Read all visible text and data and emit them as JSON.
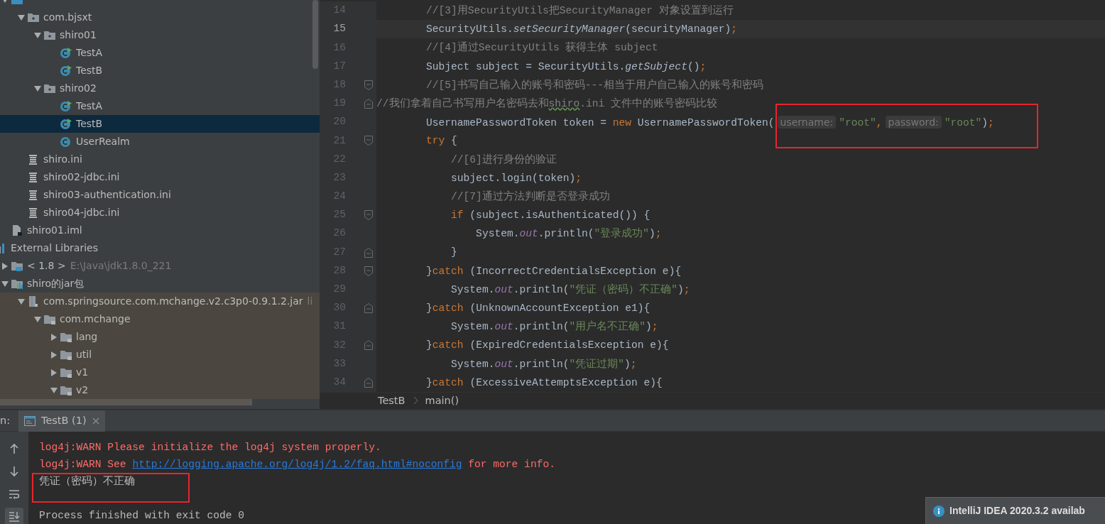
{
  "project_tree": {
    "module_items": [
      {
        "kind": "source-folder",
        "expanded": true,
        "selected": false,
        "children": [
          {
            "label": "com.bjsxt",
            "kind": "package",
            "expanded": true,
            "selected": false,
            "children": [
              {
                "label": "shiro01",
                "kind": "package",
                "expanded": true,
                "selected": false,
                "children": [
                  {
                    "label": "TestA",
                    "kind": "class-runnable",
                    "selected": false
                  },
                  {
                    "label": "TestB",
                    "kind": "class-runnable",
                    "selected": false
                  }
                ]
              },
              {
                "label": "shiro02",
                "kind": "package",
                "expanded": true,
                "selected": false,
                "children": [
                  {
                    "label": "TestA",
                    "kind": "class-runnable",
                    "selected": false
                  },
                  {
                    "label": "TestB",
                    "kind": "class-runnable",
                    "selected": true
                  },
                  {
                    "label": "UserRealm",
                    "kind": "class",
                    "selected": false
                  }
                ]
              }
            ]
          },
          {
            "label": "shiro.ini",
            "kind": "ini",
            "selected": false
          },
          {
            "label": "shiro02-jdbc.ini",
            "kind": "ini",
            "selected": false
          },
          {
            "label": "shiro03-authentication.ini",
            "kind": "ini",
            "selected": false
          },
          {
            "label": "shiro04-jdbc.ini",
            "kind": "ini",
            "selected": false
          }
        ]
      },
      {
        "label": "shiro01.iml",
        "kind": "iml",
        "selected": false
      }
    ],
    "libraries": [
      {
        "label": "External Libraries",
        "kind": "libraries",
        "selected": false,
        "children": [
          {
            "label": "< 1.8 >",
            "hint": "E:\\Java\\jdk1.8.0_221",
            "kind": "jdk",
            "expanded": false,
            "selected": false
          },
          {
            "label": "shiro的jar包",
            "kind": "library",
            "expanded": true,
            "selected": false,
            "children": [
              {
                "label": "com.springsource.com.mchange.v2.c3p0-0.9.1.2.jar",
                "hint": "li",
                "kind": "jar",
                "expanded": true,
                "selected": false,
                "non_project": true,
                "children": [
                  {
                    "label": "com.mchange",
                    "kind": "locked-folder",
                    "expanded": true,
                    "selected": false,
                    "non_project": true,
                    "children": [
                      {
                        "label": "lang",
                        "kind": "locked-folder",
                        "expanded": false,
                        "selected": false,
                        "non_project": true
                      },
                      {
                        "label": "util",
                        "kind": "locked-folder",
                        "expanded": false,
                        "selected": false,
                        "non_project": true
                      },
                      {
                        "label": "v1",
                        "kind": "locked-folder",
                        "expanded": false,
                        "selected": false,
                        "non_project": true
                      },
                      {
                        "label": "v2",
                        "kind": "locked-folder",
                        "expanded": true,
                        "selected": false,
                        "non_project": true
                      }
                    ]
                  }
                ]
              }
            ]
          }
        ]
      }
    ]
  },
  "editor": {
    "lines": [
      {
        "number": "14",
        "current": false,
        "kind": "plain",
        "segments": [
          {
            "kind": "comment",
            "text": "        //[3]用SecurityUtils把SecurityManager 对象设置到运行"
          }
        ]
      },
      {
        "number": "15",
        "current": true,
        "kind": "plain",
        "segments": [
          {
            "kind": "plain",
            "text": "        SecurityUtils."
          },
          {
            "kind": "method",
            "text": "setSecurityManager"
          },
          {
            "kind": "plain",
            "text": "(securityManager)"
          },
          {
            "kind": "punct",
            "text": ";"
          }
        ]
      },
      {
        "number": "16",
        "current": false,
        "kind": "plain",
        "segments": [
          {
            "kind": "comment",
            "text": "        //[4]通过SecurityUtils 获得主体 subject"
          }
        ]
      },
      {
        "number": "17",
        "current": false,
        "kind": "plain",
        "segments": [
          {
            "kind": "plain",
            "text": "        Subject subject = SecurityUtils."
          },
          {
            "kind": "method",
            "text": "getSubject"
          },
          {
            "kind": "plain",
            "text": "()"
          },
          {
            "kind": "punct",
            "text": ";"
          }
        ]
      },
      {
        "number": "18",
        "current": false,
        "kind": "fold-start",
        "segments": [
          {
            "kind": "comment",
            "text": "        //[5]书写自己输入的账号和密码---相当于用户自己输入的账号和密码"
          }
        ]
      },
      {
        "number": "19",
        "current": false,
        "kind": "fold-end",
        "segments": [
          {
            "kind": "comment",
            "text": "//我们拿着自己书写用户名密码去和"
          },
          {
            "kind": "typo",
            "text": "shiro"
          },
          {
            "kind": "comment",
            "text": ".ini 文件中的账号密码比较"
          }
        ]
      },
      {
        "number": "20",
        "current": false,
        "kind": "plain",
        "segments": [
          {
            "kind": "plain",
            "text": "        UsernamePasswordToken token = "
          },
          {
            "kind": "keyword",
            "text": "new"
          },
          {
            "kind": "plain",
            "text": " UsernamePasswordToken("
          },
          {
            "kind": "hint",
            "text": "username:"
          },
          {
            "kind": "string",
            "text": "\"root\""
          },
          {
            "kind": "punct",
            "text": ","
          },
          {
            "kind": "hint",
            "text": "password:"
          },
          {
            "kind": "string",
            "text": "\"root\""
          },
          {
            "kind": "plain",
            "text": ")"
          },
          {
            "kind": "punct",
            "text": ";"
          }
        ]
      },
      {
        "number": "21",
        "current": false,
        "kind": "fold-start",
        "segments": [
          {
            "kind": "keyword",
            "text": "        try"
          },
          {
            "kind": "plain",
            "text": " {"
          }
        ]
      },
      {
        "number": "22",
        "current": false,
        "kind": "plain",
        "segments": [
          {
            "kind": "comment",
            "text": "            //[6]进行身份的验证"
          }
        ]
      },
      {
        "number": "23",
        "current": false,
        "kind": "plain",
        "segments": [
          {
            "kind": "plain",
            "text": "            subject.login(token)"
          },
          {
            "kind": "punct",
            "text": ";"
          }
        ]
      },
      {
        "number": "24",
        "current": false,
        "kind": "plain",
        "segments": [
          {
            "kind": "comment",
            "text": "            //[7]通过方法判断是否登录成功"
          }
        ]
      },
      {
        "number": "25",
        "current": false,
        "kind": "fold-start",
        "segments": [
          {
            "kind": "keyword",
            "text": "            if"
          },
          {
            "kind": "plain",
            "text": " (subject.isAuthenticated()) {"
          }
        ]
      },
      {
        "number": "26",
        "current": false,
        "kind": "plain",
        "segments": [
          {
            "kind": "plain",
            "text": "                System."
          },
          {
            "kind": "field",
            "text": "out"
          },
          {
            "kind": "plain",
            "text": ".println("
          },
          {
            "kind": "string",
            "text": "\"登录成功\""
          },
          {
            "kind": "plain",
            "text": ")"
          },
          {
            "kind": "punct",
            "text": ";"
          }
        ]
      },
      {
        "number": "27",
        "current": false,
        "kind": "fold-end",
        "segments": [
          {
            "kind": "plain",
            "text": "            }"
          }
        ]
      },
      {
        "number": "28",
        "current": false,
        "kind": "fold-start",
        "segments": [
          {
            "kind": "plain",
            "text": "        }"
          },
          {
            "kind": "keyword",
            "text": "catch"
          },
          {
            "kind": "plain",
            "text": " (IncorrectCredentialsException e){"
          }
        ]
      },
      {
        "number": "29",
        "current": false,
        "kind": "plain",
        "segments": [
          {
            "kind": "plain",
            "text": "            System."
          },
          {
            "kind": "field",
            "text": "out"
          },
          {
            "kind": "plain",
            "text": ".println("
          },
          {
            "kind": "string",
            "text": "\"凭证（密码）不正确\""
          },
          {
            "kind": "plain",
            "text": ")"
          },
          {
            "kind": "punct",
            "text": ";"
          }
        ]
      },
      {
        "number": "30",
        "current": false,
        "kind": "fold-end",
        "segments": [
          {
            "kind": "plain",
            "text": "        }"
          },
          {
            "kind": "keyword",
            "text": "catch"
          },
          {
            "kind": "plain",
            "text": " (UnknownAccountException e1){"
          }
        ]
      },
      {
        "number": "31",
        "current": false,
        "kind": "plain",
        "segments": [
          {
            "kind": "plain",
            "text": "            System."
          },
          {
            "kind": "field",
            "text": "out"
          },
          {
            "kind": "plain",
            "text": ".println("
          },
          {
            "kind": "string",
            "text": "\"用户名不正确\""
          },
          {
            "kind": "plain",
            "text": ")"
          },
          {
            "kind": "punct",
            "text": ";"
          }
        ]
      },
      {
        "number": "32",
        "current": false,
        "kind": "fold-end",
        "segments": [
          {
            "kind": "plain",
            "text": "        }"
          },
          {
            "kind": "keyword",
            "text": "catch"
          },
          {
            "kind": "plain",
            "text": " (ExpiredCredentialsException e){"
          }
        ]
      },
      {
        "number": "33",
        "current": false,
        "kind": "plain",
        "segments": [
          {
            "kind": "plain",
            "text": "            System."
          },
          {
            "kind": "field",
            "text": "out"
          },
          {
            "kind": "plain",
            "text": ".println("
          },
          {
            "kind": "string",
            "text": "\"凭证过期\""
          },
          {
            "kind": "plain",
            "text": ")"
          },
          {
            "kind": "punct",
            "text": ";"
          }
        ]
      },
      {
        "number": "34",
        "current": false,
        "kind": "fold-end",
        "segments": [
          {
            "kind": "plain",
            "text": "        }"
          },
          {
            "kind": "keyword",
            "text": "catch"
          },
          {
            "kind": "plain",
            "text": " (ExcessiveAttemptsException e){"
          }
        ]
      }
    ],
    "breadcrumbs": [
      "TestB",
      "main()"
    ]
  },
  "run_panel": {
    "label": "n:",
    "tabs": [
      {
        "label": "TestB (1)",
        "selected": true
      }
    ],
    "toolbar": [
      {
        "kind": "up",
        "selected": false
      },
      {
        "kind": "down",
        "selected": false
      },
      {
        "kind": "wrap",
        "selected": false
      },
      {
        "kind": "scroll-end",
        "selected": true
      }
    ],
    "console": [
      {
        "kind": "error",
        "segments": [
          {
            "kind": "text",
            "text": "log4j:WARN Please initialize the log4j system properly."
          }
        ]
      },
      {
        "kind": "error",
        "segments": [
          {
            "kind": "text",
            "text": "log4j:WARN See "
          },
          {
            "kind": "link",
            "text": "http://logging.apache.org/log4j/1.2/faq.html#noconfig"
          },
          {
            "kind": "text",
            "text": " for more info."
          }
        ]
      },
      {
        "kind": "output",
        "segments": [
          {
            "kind": "text",
            "text": "凭证（密码）不正确"
          }
        ]
      },
      {
        "kind": "blank"
      },
      {
        "kind": "system",
        "segments": [
          {
            "kind": "text",
            "text": "Process finished with exit code 0"
          }
        ]
      }
    ]
  },
  "notification": {
    "text": "IntelliJ IDEA 2020.3.2 availab"
  }
}
